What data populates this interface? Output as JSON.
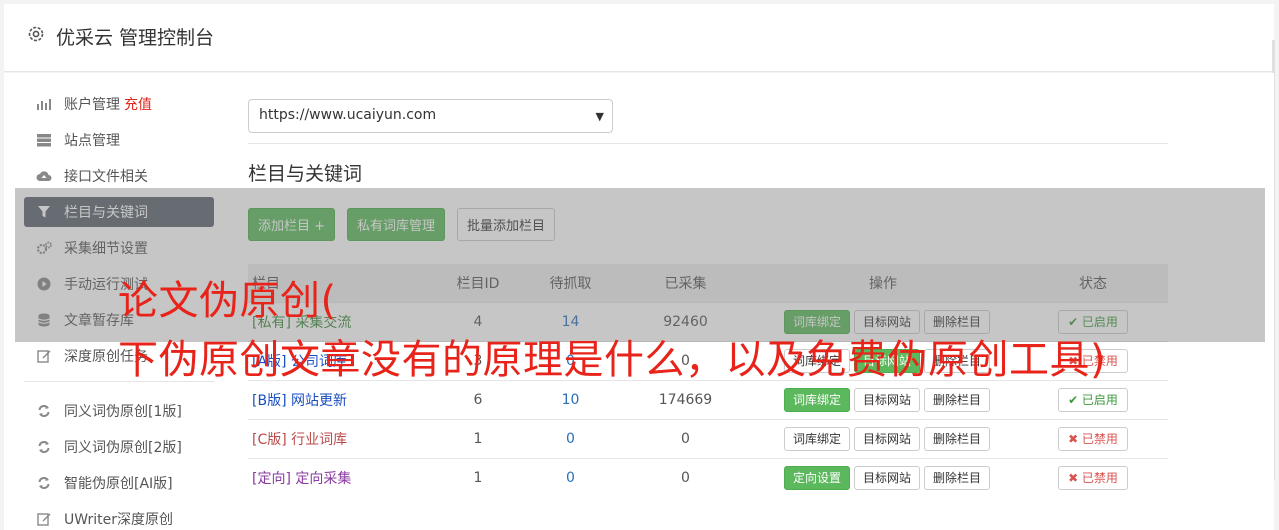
{
  "header": {
    "title": "优采云 管理控制台"
  },
  "sidebar": {
    "items": [
      {
        "label": "账户管理",
        "extra": "充值"
      },
      {
        "label": "站点管理"
      },
      {
        "label": "接口文件相关"
      },
      {
        "label": "栏目与关键词"
      },
      {
        "label": "采集细节设置"
      },
      {
        "label": "手动运行测试"
      },
      {
        "label": "文章暂存库"
      },
      {
        "label": "深度原创任务"
      }
    ],
    "items2": [
      {
        "label": "同义词伪原创[1版]"
      },
      {
        "label": "同义词伪原创[2版]"
      },
      {
        "label": "智能伪原创[AI版]"
      },
      {
        "label": "UWriter深度原创"
      }
    ]
  },
  "site_select": {
    "value": "https://www.ucaiyun.com"
  },
  "section": {
    "title": "栏目与关键词"
  },
  "toolbar": {
    "add": "添加栏目 +",
    "private": "私有词库管理",
    "batch": "批量添加栏目"
  },
  "table": {
    "headers": [
      "栏目",
      "栏目ID",
      "待抓取",
      "已采集",
      "操作",
      "状态"
    ],
    "rows": [
      {
        "tag": "[私有]",
        "name": "采集交流",
        "id": "4",
        "pending": "14",
        "collected": "92460",
        "op1": "词库绑定",
        "op2": "目标网站",
        "op3": "删除栏目",
        "status": "✔ 已启用"
      },
      {
        "tag": "[A版]",
        "name": "公司词库",
        "id": "3",
        "pending": "0",
        "collected": "0",
        "op1": "词库绑定",
        "op2": "目标网站",
        "op3": "删除栏目",
        "status": "✖ 已禁用"
      },
      {
        "tag": "[B版]",
        "name": "网站更新",
        "id": "6",
        "pending": "10",
        "collected": "174669",
        "op1": "词库绑定",
        "op2": "目标网站",
        "op3": "删除栏目",
        "status": "✔ 已启用"
      },
      {
        "tag": "[C版]",
        "name": "行业词库",
        "id": "1",
        "pending": "0",
        "collected": "0",
        "op1": "词库绑定",
        "op2": "目标网站",
        "op3": "删除栏目",
        "status": "✖ 已禁用"
      },
      {
        "tag": "[定向]",
        "name": "定向采集",
        "id": "1",
        "pending": "0",
        "collected": "0",
        "op1": "定向设置",
        "op2": "目标网站",
        "op3": "删除栏目",
        "status": "✖ 已禁用"
      }
    ]
  },
  "overlay": {
    "line1": "论文伪原创(",
    "line2": "下伪原创文章没有的原理是什么，以及免费伪原创工具)"
  }
}
